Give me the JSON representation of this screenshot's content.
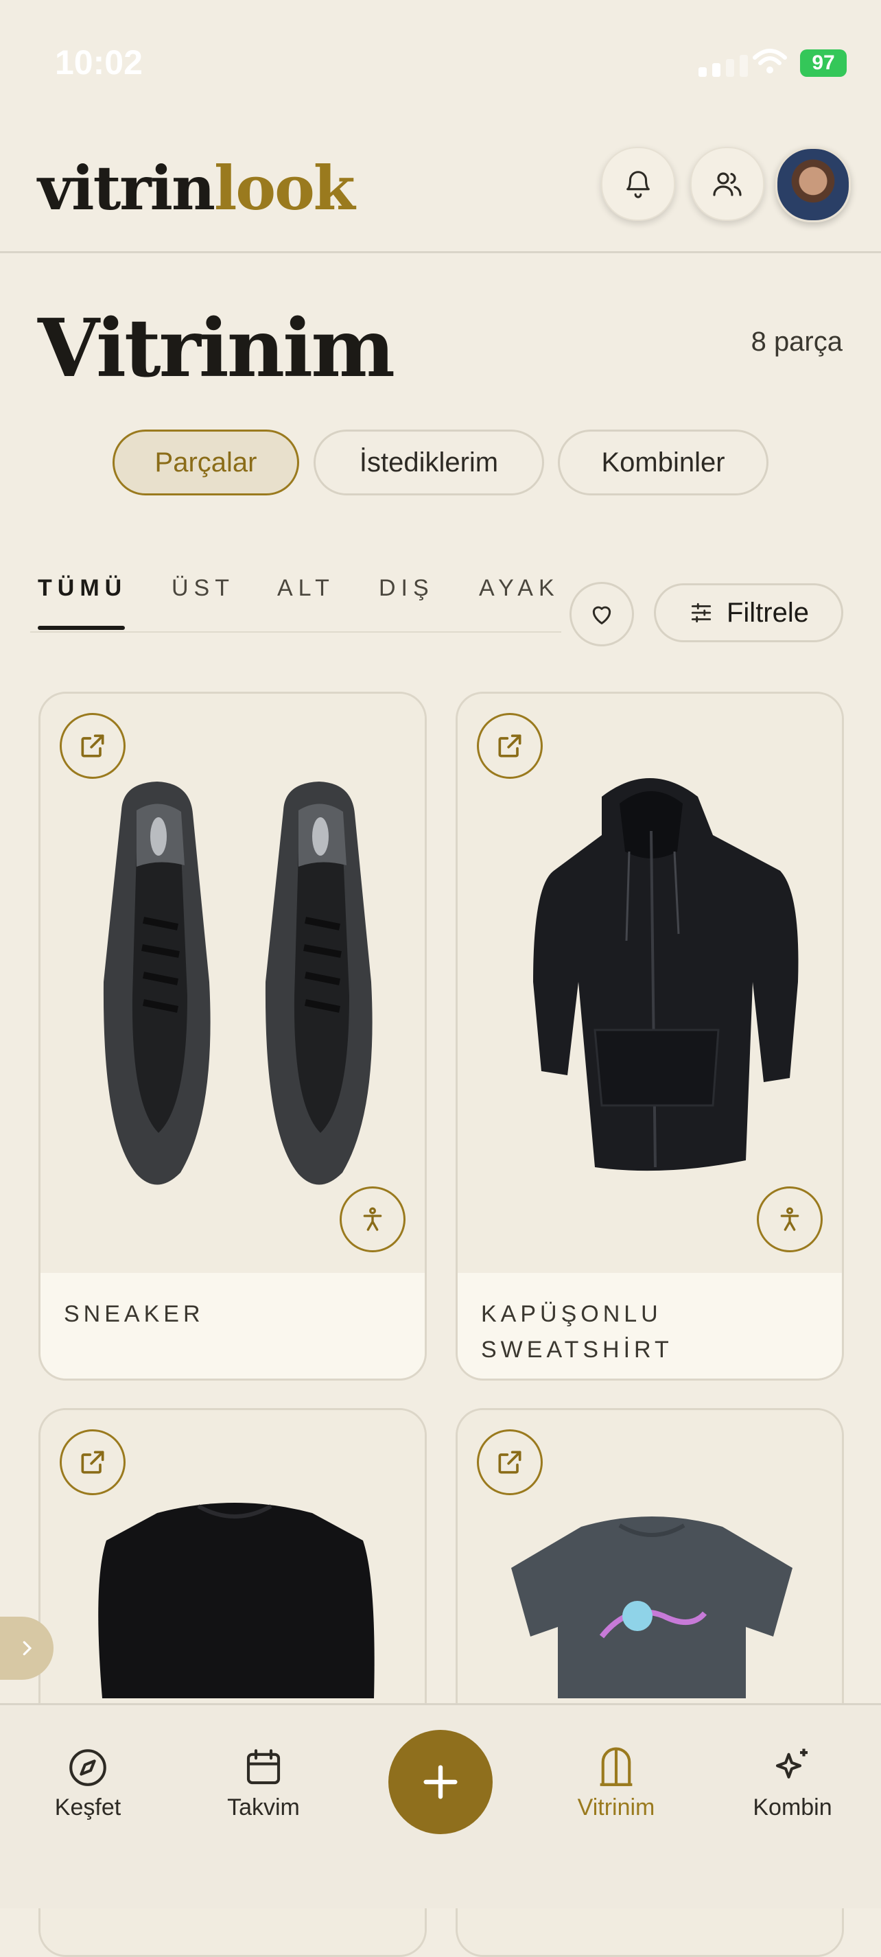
{
  "status": {
    "time": "10:02",
    "battery": "97"
  },
  "header": {
    "logo_part1": "vitrin",
    "logo_part2": "look",
    "icons": [
      "bell-icon",
      "people-icon",
      "avatar"
    ]
  },
  "page": {
    "title": "Vitrinim",
    "count": "8 parça"
  },
  "segments": [
    {
      "label": "Parçalar",
      "active": true
    },
    {
      "label": "İstediklerim",
      "active": false
    },
    {
      "label": "Kombinler",
      "active": false
    }
  ],
  "categories": [
    {
      "label": "TÜMÜ",
      "active": true
    },
    {
      "label": "ÜST",
      "active": false
    },
    {
      "label": "ALT",
      "active": false
    },
    {
      "label": "DIŞ",
      "active": false
    },
    {
      "label": "AYAKI",
      "active": false
    }
  ],
  "filter": {
    "label": "Filtrele"
  },
  "items": [
    {
      "label": "SNEAKER",
      "image": "black-gray-sneakers"
    },
    {
      "label_line1": "KAPÜŞONLU",
      "label_line2": "SWEATSHİRT",
      "image": "black-zip-hoodie"
    },
    {
      "label": "",
      "image": "black-long-sleeve-top"
    },
    {
      "label": "",
      "image": "gray-graphic-tshirt"
    }
  ],
  "nav": [
    {
      "label": "Keşfet",
      "icon": "compass-icon",
      "active": false
    },
    {
      "label": "Takvim",
      "icon": "calendar-icon",
      "active": false
    },
    {
      "label": "",
      "icon": "plus-icon",
      "active": false
    },
    {
      "label": "Vitrinim",
      "icon": "wardrobe-icon",
      "active": true
    },
    {
      "label": "Kombin",
      "icon": "sparkles-icon",
      "active": false
    }
  ],
  "colors": {
    "accent": "#9a7a1e",
    "background": "#f2ede2",
    "fab": "#8f6f1d"
  }
}
